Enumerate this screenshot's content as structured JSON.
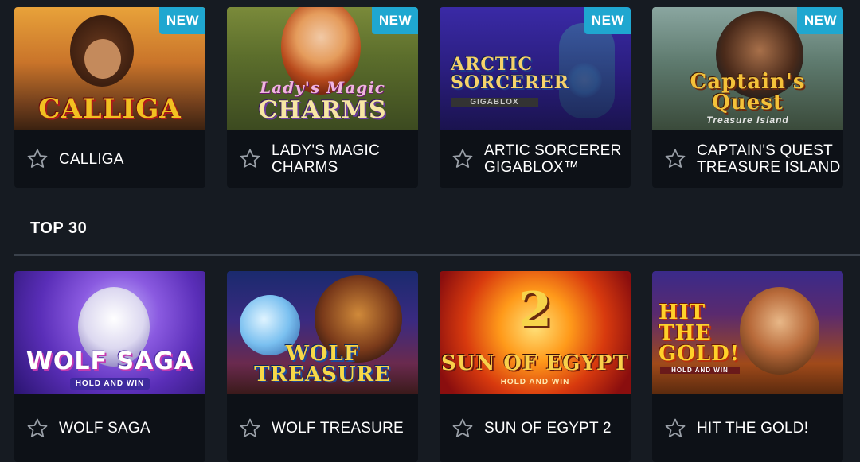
{
  "new_games": [
    {
      "title": "CALLIGA",
      "logo": "CALLIGA",
      "badge": "NEW",
      "icon": "star-outline-icon"
    },
    {
      "title": "LADY'S MAGIC CHARMS",
      "logo": "CHARMS",
      "logo_script": "Lady's Magic",
      "badge": "NEW",
      "icon": "star-outline-icon"
    },
    {
      "title": "ARTIC SORCERER GIGABLOX™",
      "logo": "ARCTIC SORCERER",
      "logo_sub": "GIGABLOX",
      "badge": "NEW",
      "icon": "star-outline-icon"
    },
    {
      "title": "CAPTAIN'S QUEST TREASURE ISLAND",
      "logo": "Captain's Quest",
      "logo_sub": "Treasure Island",
      "badge": "NEW",
      "icon": "star-outline-icon"
    }
  ],
  "section": {
    "title": "TOP 30"
  },
  "top_games": [
    {
      "title": "WOLF SAGA",
      "logo": "WOLF SAGA",
      "logo_sub": "HOLD AND WIN",
      "icon": "star-outline-icon"
    },
    {
      "title": "WOLF TREASURE",
      "logo": "WOLF TREASURE",
      "icon": "star-outline-icon"
    },
    {
      "title": "SUN OF EGYPT 2",
      "logo": "SUN OF EGYPT",
      "logo_num": "2",
      "logo_sub": "HOLD AND WIN",
      "icon": "star-outline-icon"
    },
    {
      "title": "HIT THE GOLD!",
      "logo": "HIT THE GOLD!",
      "logo_sub": "HOLD AND WIN",
      "icon": "star-outline-icon"
    }
  ],
  "colors": {
    "background": "#161b22",
    "card": "#0d1117",
    "badge": "#1fa7d0",
    "divider": "#3a414b"
  }
}
